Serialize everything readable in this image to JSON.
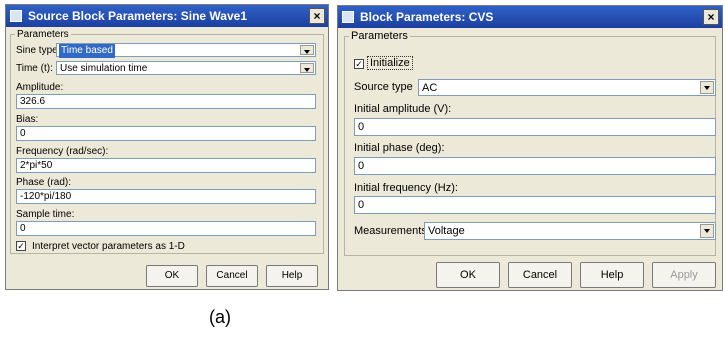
{
  "left_dialog": {
    "title": "Source Block Parameters: Sine Wave1",
    "group_label": "Parameters",
    "sine_type_label": "Sine type:",
    "sine_type_value": "Time based",
    "time_label": "Time (t):",
    "time_value": "Use simulation time",
    "amplitude_label": "Amplitude:",
    "amplitude_value": "326.6",
    "bias_label": "Bias:",
    "bias_value": "0",
    "frequency_label": "Frequency (rad/sec):",
    "frequency_value": "2*pi*50",
    "phase_label": "Phase (rad):",
    "phase_value": "-120*pi/180",
    "sample_time_label": "Sample time:",
    "sample_time_value": "0",
    "interpret_label": "Interpret vector parameters as 1-D",
    "interpret_checked": true,
    "buttons": {
      "ok": "OK",
      "cancel": "Cancel",
      "help": "Help"
    }
  },
  "right_dialog": {
    "title": "Block Parameters: CVS",
    "group_label": "Parameters",
    "initialize_label": "Initialize",
    "initialize_checked": true,
    "source_type_label": "Source type",
    "source_type_value": "AC",
    "initial_amplitude_label": "Initial amplitude (V):",
    "initial_amplitude_value": "0",
    "initial_phase_label": "Initial phase (deg):",
    "initial_phase_value": "0",
    "initial_frequency_label": "Initial frequency (Hz):",
    "initial_frequency_value": "0",
    "measurements_label": "Measurements",
    "measurements_value": "Voltage",
    "buttons": {
      "ok": "OK",
      "cancel": "Cancel",
      "help": "Help",
      "apply": "Apply"
    }
  },
  "caption": "(a)",
  "close_glyph": "×",
  "check_glyph": "✓",
  "colors": {
    "title_bar": "#1d3fa0",
    "dialog_bg": "#ece9d8",
    "selection": "#316ac5"
  }
}
